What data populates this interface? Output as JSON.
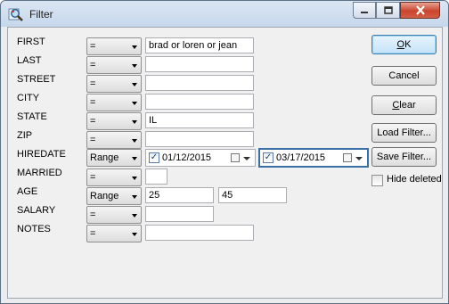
{
  "window": {
    "title": "Filter",
    "icon": "magnifier-icon",
    "controls": [
      "minimize-icon",
      "maximize-icon",
      "close-icon"
    ]
  },
  "rows": [
    {
      "label": "FIRST",
      "op": "=",
      "value": "brad or loren or jean"
    },
    {
      "label": "LAST",
      "op": "=",
      "value": ""
    },
    {
      "label": "STREET",
      "op": "=",
      "value": ""
    },
    {
      "label": "CITY",
      "op": "=",
      "value": ""
    },
    {
      "label": "STATE",
      "op": "=",
      "value": "IL"
    },
    {
      "label": "ZIP",
      "op": "=",
      "value": ""
    },
    {
      "label": "HIREDATE",
      "op": "Range",
      "from": "01/12/2015",
      "to": "03/17/2015"
    },
    {
      "label": "MARRIED",
      "op": "=",
      "value": ""
    },
    {
      "label": "AGE",
      "op": "Range",
      "from": "25",
      "to": "45"
    },
    {
      "label": "SALARY",
      "op": "=",
      "value": ""
    },
    {
      "label": "NOTES",
      "op": "=",
      "value": ""
    }
  ],
  "buttons": {
    "ok": {
      "prefix": "",
      "mnemonic": "O",
      "rest": "K"
    },
    "cancel": "Cancel",
    "clear": {
      "prefix": "",
      "mnemonic": "C",
      "rest": "lear"
    },
    "load": "Load Filter...",
    "save": "Save Filter..."
  },
  "hide_deleted": {
    "label": "Hide deleted",
    "checked": false
  }
}
